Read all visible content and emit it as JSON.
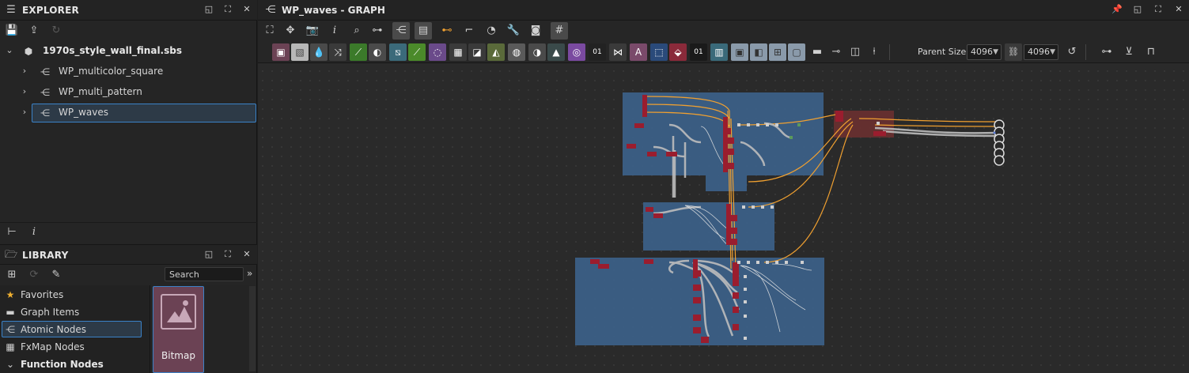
{
  "explorer": {
    "title": "EXPLORER",
    "package": "1970s_style_wall_final.sbs",
    "items": [
      {
        "label": "WP_multicolor_square"
      },
      {
        "label": "WP_multi_pattern"
      },
      {
        "label": "WP_waves"
      }
    ]
  },
  "library": {
    "title": "LIBRARY",
    "search_placeholder": "Search",
    "categories": [
      {
        "label": "Favorites",
        "icon": "star-icon"
      },
      {
        "label": "Graph Items",
        "icon": "comment-icon"
      },
      {
        "label": "Atomic Nodes",
        "icon": "atomic-nodes-icon"
      },
      {
        "label": "FxMap Nodes",
        "icon": "grid-icon"
      },
      {
        "label": "Function Nodes",
        "icon": "chevron-down-icon"
      }
    ],
    "tile_label": "Bitmap"
  },
  "graph": {
    "title": "WP_waves - GRAPH",
    "parent_size_label": "Parent Size:",
    "width_value": "4096",
    "height_value": "4096"
  },
  "colors": {
    "frame_blue": "#3b5f86",
    "frame_red": "#6a3030",
    "node_red": "#9a1d2e",
    "link_orange": "#f0a030",
    "link_gray": "#bdbdbd",
    "selection": "#3a82c8"
  }
}
